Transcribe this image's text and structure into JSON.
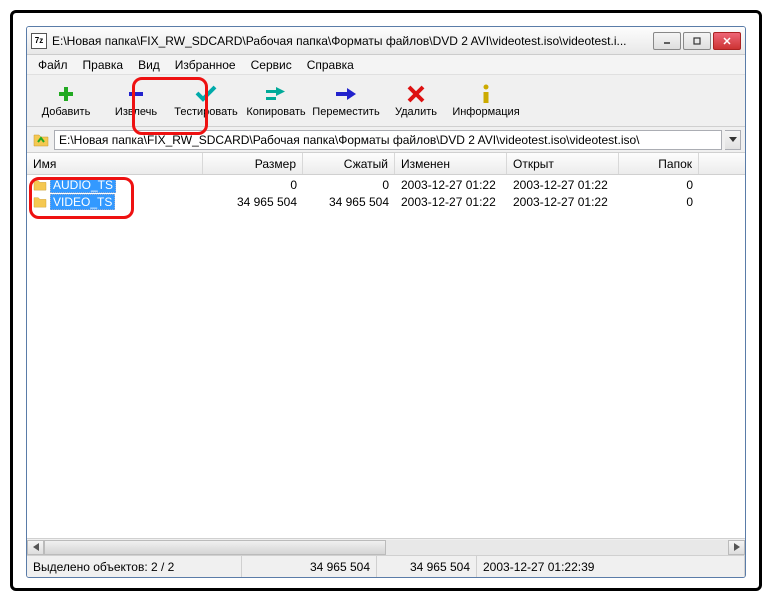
{
  "titlebar": {
    "icon_text": "7z",
    "title": "E:\\Новая папка\\FIX_RW_SDCARD\\Рабочая папка\\Форматы файлов\\DVD 2 AVI\\videotest.iso\\videotest.i..."
  },
  "menubar": {
    "file": "Файл",
    "edit": "Правка",
    "view": "Вид",
    "favorites": "Избранное",
    "tools": "Сервис",
    "help": "Справка"
  },
  "toolbar": {
    "add": "Добавить",
    "extract": "Извлечь",
    "test": "Тестировать",
    "copy": "Копировать",
    "move": "Переместить",
    "delete": "Удалить",
    "info": "Информация"
  },
  "address": {
    "path": "E:\\Новая папка\\FIX_RW_SDCARD\\Рабочая папка\\Форматы файлов\\DVD 2 AVI\\videotest.iso\\videotest.iso\\"
  },
  "columns": {
    "name": "Имя",
    "size": "Размер",
    "packed": "Сжатый",
    "modified": "Изменен",
    "opened": "Открыт",
    "folders": "Папок"
  },
  "rows": [
    {
      "name": "AUDIO_TS",
      "size": "0",
      "packed": "0",
      "modified": "2003-12-27 01:22",
      "opened": "2003-12-27 01:22",
      "folders": "0"
    },
    {
      "name": "VIDEO_TS",
      "size": "34 965 504",
      "packed": "34 965 504",
      "modified": "2003-12-27 01:22",
      "opened": "2003-12-27 01:22",
      "folders": "0"
    }
  ],
  "status": {
    "selected": "Выделено объектов: 2 / 2",
    "size": "34 965 504",
    "packed": "34 965 504",
    "date": "2003-12-27 01:22:39"
  }
}
